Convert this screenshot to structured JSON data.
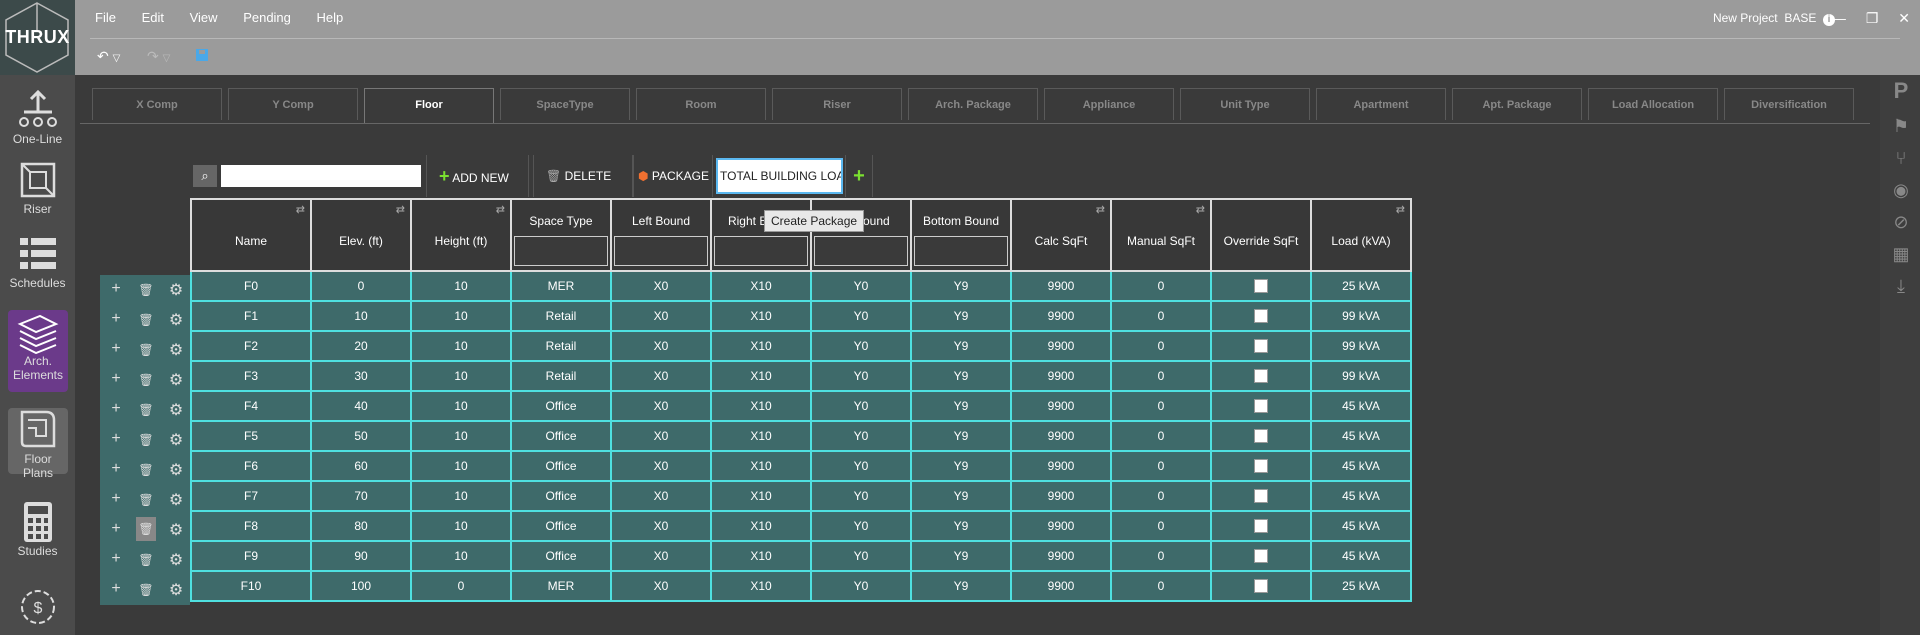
{
  "app": {
    "logo_text": "THRUX",
    "project": "New Project",
    "branch": "BASE"
  },
  "menu": [
    "File",
    "Edit",
    "View",
    "Pending",
    "Help"
  ],
  "nav": [
    {
      "label": "One-Line",
      "icon": "one-line-icon"
    },
    {
      "label": "Riser",
      "icon": "riser-icon"
    },
    {
      "label": "Schedules",
      "icon": "schedules-icon"
    },
    {
      "label": "Arch. Elements",
      "icon": "arch-elements-icon"
    },
    {
      "label": "Floor Plans",
      "icon": "floor-plans-icon"
    },
    {
      "label": "Studies",
      "icon": "calculator-icon"
    }
  ],
  "tabs": [
    "X Comp",
    "Y Comp",
    "Floor",
    "SpaceType",
    "Room",
    "Riser",
    "Arch. Package",
    "Appliance",
    "Unit Type",
    "Apartment",
    "Apt. Package",
    "Load Allocation",
    "Diversification"
  ],
  "active_tab": "Floor",
  "toolbar": {
    "add_label": "ADD NEW",
    "delete_label": "DELETE",
    "package_label": "PACKAGE",
    "package_value": "TOTAL BUILDING LOAD",
    "search_value": ""
  },
  "tooltip": "Create Package",
  "columns": [
    "Name",
    "Elev. (ft)",
    "Height (ft)",
    "Space Type",
    "Left Bound",
    "Right Bound",
    "Top Bound",
    "Bottom Bound",
    "Calc SqFt",
    "Manual SqFt",
    "Override SqFt",
    "Load (kVA)"
  ],
  "rows": [
    [
      "F0",
      "0",
      "10",
      "MER",
      "X0",
      "X10",
      "Y0",
      "Y9",
      "9900",
      "0",
      "",
      "25 kVA"
    ],
    [
      "F1",
      "10",
      "10",
      "Retail",
      "X0",
      "X10",
      "Y0",
      "Y9",
      "9900",
      "0",
      "",
      "99 kVA"
    ],
    [
      "F2",
      "20",
      "10",
      "Retail",
      "X0",
      "X10",
      "Y0",
      "Y9",
      "9900",
      "0",
      "",
      "99 kVA"
    ],
    [
      "F3",
      "30",
      "10",
      "Retail",
      "X0",
      "X10",
      "Y0",
      "Y9",
      "9900",
      "0",
      "",
      "99 kVA"
    ],
    [
      "F4",
      "40",
      "10",
      "Office",
      "X0",
      "X10",
      "Y0",
      "Y9",
      "9900",
      "0",
      "",
      "45 kVA"
    ],
    [
      "F5",
      "50",
      "10",
      "Office",
      "X0",
      "X10",
      "Y0",
      "Y9",
      "9900",
      "0",
      "",
      "45 kVA"
    ],
    [
      "F6",
      "60",
      "10",
      "Office",
      "X0",
      "X10",
      "Y0",
      "Y9",
      "9900",
      "0",
      "",
      "45 kVA"
    ],
    [
      "F7",
      "70",
      "10",
      "Office",
      "X0",
      "X10",
      "Y0",
      "Y9",
      "9900",
      "0",
      "",
      "45 kVA"
    ],
    [
      "F8",
      "80",
      "10",
      "Office",
      "X0",
      "X10",
      "Y0",
      "Y9",
      "9900",
      "0",
      "",
      "45 kVA"
    ],
    [
      "F9",
      "90",
      "10",
      "Office",
      "X0",
      "X10",
      "Y0",
      "Y9",
      "9900",
      "0",
      "",
      "45 kVA"
    ],
    [
      "F10",
      "100",
      "0",
      "MER",
      "X0",
      "X10",
      "Y0",
      "Y9",
      "9900",
      "0",
      "",
      "25 kVA"
    ]
  ],
  "colors": {
    "row_bg": "#3e6a6a",
    "row_border": "#4fe0e0",
    "accent_purple": "#6b3a8a",
    "add_green": "#7be030"
  }
}
